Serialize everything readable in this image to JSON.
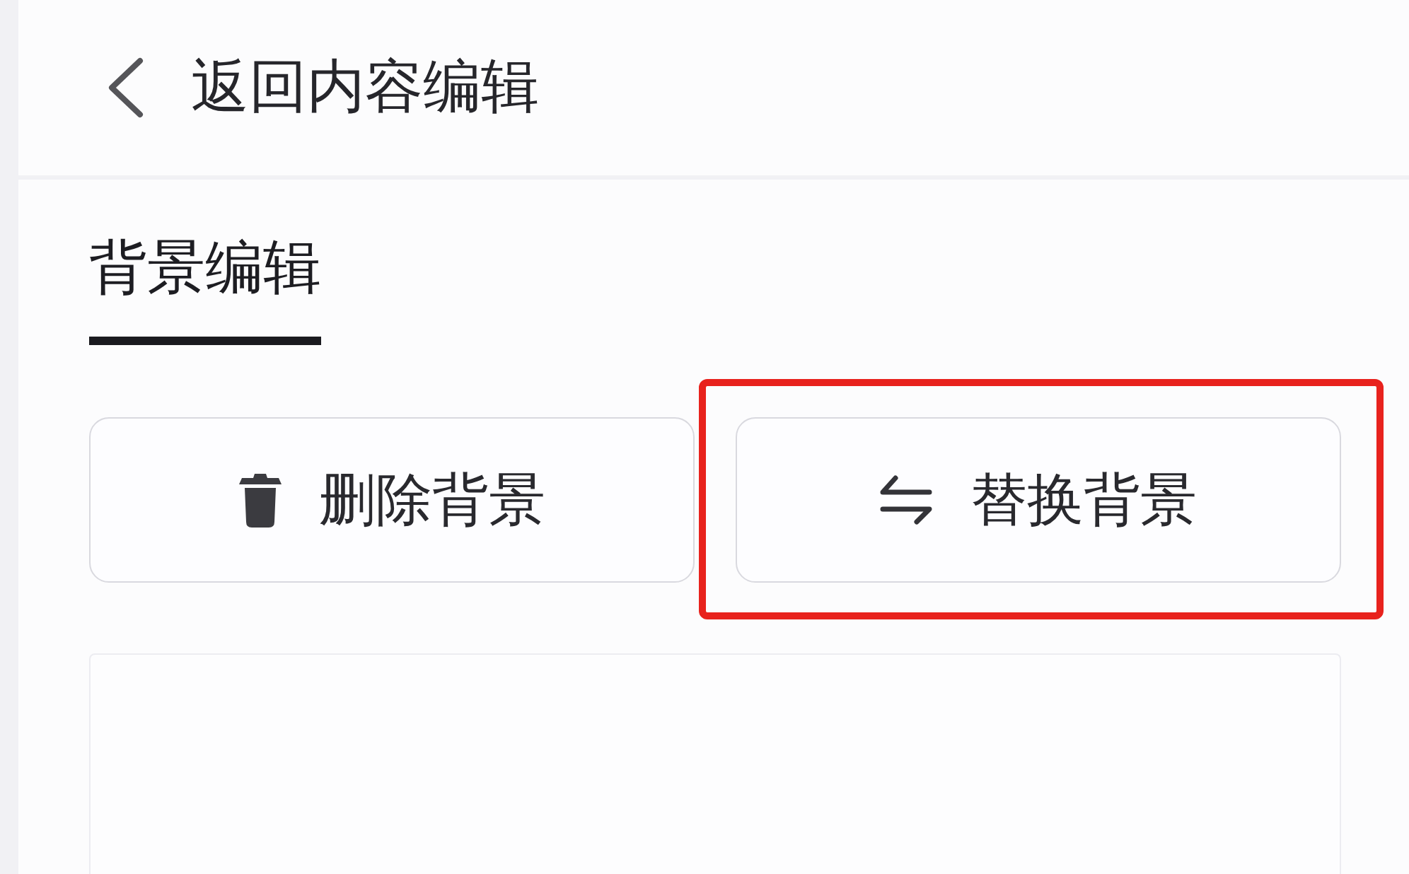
{
  "header": {
    "back_label": "返回内容编辑"
  },
  "tabs": [
    {
      "label": "背景编辑",
      "selected": true
    }
  ],
  "buttons": [
    {
      "kind": "delete",
      "label": "删除背景",
      "highlighted": false
    },
    {
      "kind": "swap",
      "label": "替换背景",
      "highlighted": true
    }
  ]
}
